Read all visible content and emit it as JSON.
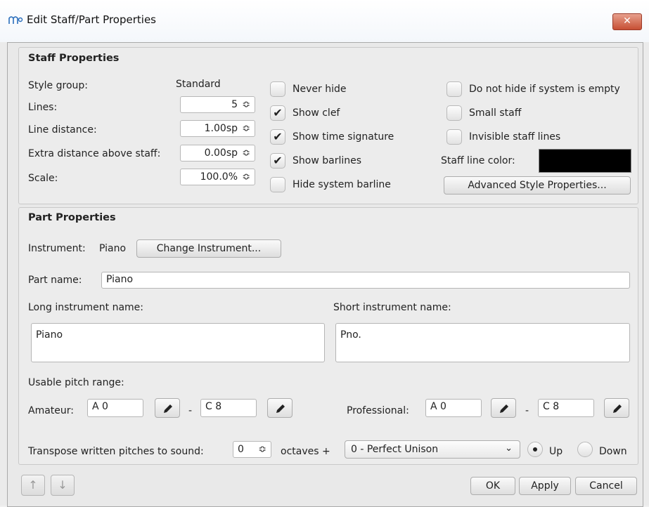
{
  "window": {
    "title": "Edit Staff/Part Properties",
    "icon": "musescore-icon",
    "close_label": "✕"
  },
  "staff": {
    "title": "Staff Properties",
    "style_group_label": "Style group:",
    "style_group_value": "Standard",
    "lines_label": "Lines:",
    "lines_value": "5",
    "line_distance_label": "Line distance:",
    "line_distance_value": "1.00sp",
    "extra_distance_label": "Extra distance above staff:",
    "extra_distance_value": "0.00sp",
    "scale_label": "Scale:",
    "scale_value": "100.0%",
    "never_hide": {
      "label": "Never hide",
      "checked": false
    },
    "show_clef": {
      "label": "Show clef",
      "checked": true
    },
    "show_time_signature": {
      "label": "Show time signature",
      "checked": true
    },
    "show_barlines": {
      "label": "Show barlines",
      "checked": true
    },
    "hide_system_barline": {
      "label": "Hide system barline",
      "checked": false
    },
    "do_not_hide": {
      "label": "Do not hide if system is empty",
      "checked": false
    },
    "small_staff": {
      "label": "Small staff",
      "checked": false
    },
    "invisible_lines": {
      "label": "Invisible staff lines",
      "checked": false
    },
    "line_color_label": "Staff line color:",
    "line_color": "#000000",
    "advanced_button": "Advanced Style Properties..."
  },
  "part": {
    "title": "Part Properties",
    "instrument_label": "Instrument:",
    "instrument_value": "Piano",
    "change_instrument_button": "Change Instrument...",
    "part_name_label": "Part name:",
    "part_name_value": "Piano",
    "long_name_label": "Long instrument name:",
    "long_name_value": "Piano",
    "short_name_label": "Short instrument name:",
    "short_name_value": "Pno.",
    "pitch_range_label": "Usable pitch range:",
    "amateur_label": "Amateur:",
    "amateur_low": "A 0",
    "amateur_high": "C 8",
    "professional_label": "Professional:",
    "pro_low": "A 0",
    "pro_high": "C 8",
    "dash": "-",
    "transpose_label": "Transpose written pitches to sound:",
    "octaves_value": "0",
    "octaves_label": "octaves +",
    "interval_value": "0 - Perfect Unison",
    "up_label": "Up",
    "down_label": "Down",
    "direction": "Up"
  },
  "footer": {
    "up_arrow": "↑",
    "down_arrow": "↓",
    "ok_label": "OK",
    "apply_label": "Apply",
    "cancel_label": "Cancel"
  }
}
